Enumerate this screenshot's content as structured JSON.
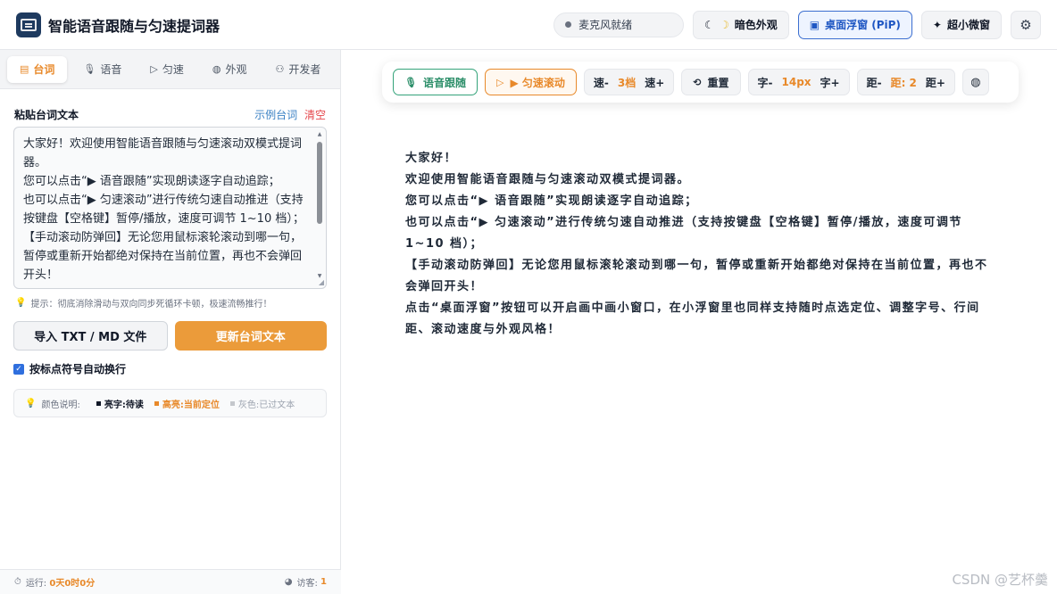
{
  "header": {
    "title": "智能语音跟随与匀速提词器",
    "mic_status": "麦克风就绪",
    "dark_mode_label": "暗色外观",
    "pip_label": "桌面浮窗 (PiP)",
    "mini_label": "超小微窗"
  },
  "sidebar": {
    "tabs": [
      {
        "label": "台词",
        "icon": "document-icon",
        "active": true
      },
      {
        "label": "语音",
        "icon": "microphone-icon",
        "active": false
      },
      {
        "label": "匀速",
        "icon": "play-icon",
        "active": false
      },
      {
        "label": "外观",
        "icon": "palette-icon",
        "active": false
      },
      {
        "label": "开发者",
        "icon": "user-icon",
        "active": false
      }
    ],
    "section_title": "粘贴台词文本",
    "sample_link": "示例台词",
    "clear_link": "清空",
    "editor_text": "大家好！欢迎使用智能语音跟随与匀速滚动双模式提词器。\n您可以点击“▶ 语音跟随”实现朗读逐字自动追踪；\n也可以点击“▶ 匀速滚动”进行传统匀速自动推进（支持按键盘【空格键】暂停/播放，速度可调节 1~10 档）；\n【手动滚动防弹回】无论您用鼠标滚轮滚动到哪一句，暂停或重新开始都绝对保持在当前位置，再也不会弹回开头！",
    "tip": "提示：彻底消除滑动与双向同步死循环卡顿，极速流畅推行！",
    "import_button": "导入 TXT / MD 文件",
    "update_button": "更新台词文本",
    "checkbox_label": "按标点符号自动换行",
    "checkbox_checked": true,
    "legend": {
      "label": "颜色说明:",
      "bright": "亮字:待读",
      "highlight": "高亮:当前定位",
      "gray": "灰色:已过文本"
    },
    "footer": {
      "runtime_label": "运行:",
      "runtime_value": "0天0时0分",
      "visitors_label": "访客:",
      "visitors_value": "1"
    }
  },
  "toolbar": {
    "voice_follow": "语音跟随",
    "uniform_scroll": "▶ 匀速滚动",
    "speed_down": "速-",
    "speed_value": "3档",
    "speed_up": "速+",
    "reset": "重置",
    "font_down": "字-",
    "font_value": "14px",
    "font_up": "字+",
    "spacing_down": "距-",
    "spacing_value": "距: 2",
    "spacing_up": "距+"
  },
  "teleprompter": {
    "lines": [
      "大家好！",
      "欢迎使用智能语音跟随与匀速滚动双模式提词器。",
      "您可以点击“▶ 语音跟随”实现朗读逐字自动追踪；",
      "也可以点击“▶ 匀速滚动”进行传统匀速自动推进（支持按键盘【空格键】暂停/播放，速度可调节 1~10 档）；",
      "【手动滚动防弹回】无论您用鼠标滚轮滚动到哪一句，暂停或重新开始都绝对保持在当前位置，再也不会弹回开头！",
      "点击“桌面浮窗”按钮可以开启画中画小窗口，在小浮窗里也同样支持随时点选定位、调整字号、行间距、滚动速度与外观风格！"
    ]
  },
  "watermark": "CSDN @艺杯羹",
  "colors": {
    "accent_orange": "#e8892a",
    "accent_green": "#34a37a",
    "accent_blue": "#1f57c3"
  }
}
